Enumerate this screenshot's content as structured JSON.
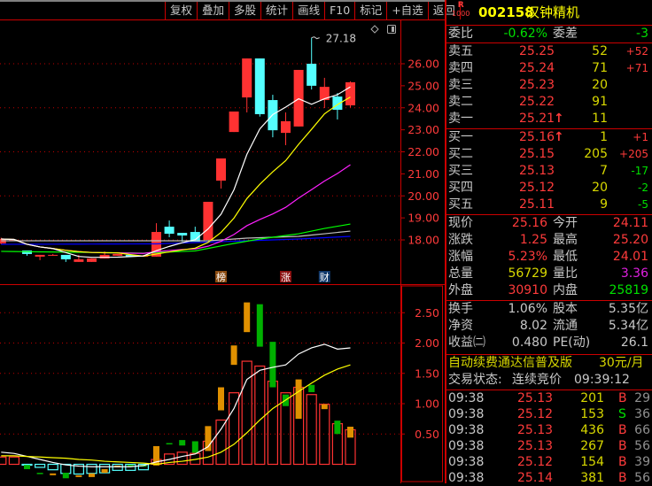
{
  "toolbar": [
    "复权",
    "叠加",
    "多股",
    "统计",
    "画线",
    "F10",
    "标记",
    "+自选",
    "返回"
  ],
  "stock": {
    "badge_top": "R",
    "badge_bottom": "1000",
    "code": "002158",
    "name": "汉钟精机"
  },
  "weibi": {
    "label": "委比",
    "value": "-0.62%",
    "label2": "委差",
    "value2": "-3"
  },
  "asks": [
    {
      "label": "卖五",
      "price": "25.25",
      "vol": "52",
      "chg": "+52",
      "chg_color": "r"
    },
    {
      "label": "卖四",
      "price": "25.24",
      "vol": "71",
      "chg": "+71",
      "chg_color": "r"
    },
    {
      "label": "卖三",
      "price": "25.23",
      "vol": "20",
      "chg": "",
      "chg_color": "r"
    },
    {
      "label": "卖二",
      "price": "25.22",
      "vol": "91",
      "chg": "",
      "chg_color": "r"
    },
    {
      "label": "卖一",
      "price": "25.21",
      "vol": "11",
      "chg": "",
      "chg_color": "r",
      "arrow": "↑"
    }
  ],
  "bids": [
    {
      "label": "买一",
      "price": "25.16",
      "vol": "1",
      "chg": "+1",
      "chg_color": "r",
      "arrow": "↑"
    },
    {
      "label": "买二",
      "price": "25.15",
      "vol": "205",
      "chg": "+205",
      "chg_color": "r"
    },
    {
      "label": "买三",
      "price": "25.13",
      "vol": "7",
      "chg": "-17",
      "chg_color": "g"
    },
    {
      "label": "买四",
      "price": "25.12",
      "vol": "20",
      "chg": "-2",
      "chg_color": "g"
    },
    {
      "label": "买五",
      "price": "25.11",
      "vol": "9",
      "chg": "-5",
      "chg_color": "g"
    }
  ],
  "quote": [
    {
      "l1": "现价",
      "v1": "25.16",
      "c1": "r",
      "l2": "今开",
      "v2": "24.11",
      "c2": "r"
    },
    {
      "l1": "涨跌",
      "v1": "1.25",
      "c1": "r",
      "l2": "最高",
      "v2": "25.20",
      "c2": "r"
    },
    {
      "l1": "涨幅",
      "v1": "5.23%",
      "c1": "r",
      "l2": "最低",
      "v2": "24.01",
      "c2": "r"
    },
    {
      "l1": "总量",
      "v1": "56729",
      "c1": "y",
      "l2": "量比",
      "v2": "3.36",
      "c2": "m"
    },
    {
      "l1": "外盘",
      "v1": "30910",
      "c1": "r",
      "l2": "内盘",
      "v2": "25819",
      "c2": "g"
    }
  ],
  "finance": [
    {
      "l1": "换手",
      "v1": "1.06%",
      "l2": "股本",
      "v2": "5.35亿"
    },
    {
      "l1": "净资",
      "v1": "8.02",
      "l2": "流通",
      "v2": "5.34亿"
    },
    {
      "l1": "收益㈡",
      "v1": "0.480",
      "l2": "PE(动)",
      "v2": "26.1"
    }
  ],
  "promo": {
    "text": "自动续费通达信普及版",
    "price": "30元/月"
  },
  "status": {
    "label": "交易状态:",
    "value": "连续竞价",
    "time": "09:39:12"
  },
  "ticks": [
    {
      "time": "09:38",
      "price": "25.13",
      "vol": "201",
      "side": "B",
      "n": "29"
    },
    {
      "time": "09:38",
      "price": "25.12",
      "vol": "153",
      "side": "S",
      "n": "36"
    },
    {
      "time": "09:38",
      "price": "25.13",
      "vol": "436",
      "side": "B",
      "n": "66"
    },
    {
      "time": "09:38",
      "price": "25.13",
      "vol": "267",
      "side": "B",
      "n": "56"
    },
    {
      "time": "09:38",
      "price": "25.12",
      "vol": "154",
      "side": "B",
      "n": "39"
    },
    {
      "time": "09:38",
      "price": "25.14",
      "vol": "381",
      "side": "B",
      "n": "56"
    }
  ],
  "markers": [
    {
      "text": "榜",
      "index": 17,
      "color": "#8a4a10"
    },
    {
      "text": "涨",
      "index": 22,
      "color": "#8a1010"
    },
    {
      "text": "财",
      "index": 25,
      "color": "#10386a"
    }
  ],
  "colors": {
    "up": "#ff3232",
    "down": "#54ffff",
    "ma5": "#ffffff",
    "ma10": "#ffff00",
    "ma20": "#ff20ff",
    "green": "#00ff00",
    "gray": "#c0c0c0",
    "blue": "#0000ff",
    "ind_up": "#e09000",
    "ind_down": "#00b000",
    "grid": "#c00000",
    "axis_text": "#ff3b3b"
  },
  "chart_data": {
    "type": "candlestick",
    "price_axis": {
      "ticks": [
        "26.00",
        "25.00",
        "24.00",
        "23.00",
        "22.00",
        "21.00",
        "20.00",
        "19.00",
        "18.00"
      ],
      "range": [
        18,
        26
      ]
    },
    "high_label": "27.18",
    "candles": [
      {
        "o": 17.84,
        "c": 18.04,
        "h": 18.1,
        "l": 17.8
      },
      {
        "o": 18.0,
        "c": 18.0,
        "h": 18.04,
        "l": 17.96
      },
      {
        "o": 17.52,
        "c": 17.36,
        "h": 17.52,
        "l": 17.28
      },
      {
        "o": 17.24,
        "c": 17.32,
        "h": 17.32,
        "l": 17.08
      },
      {
        "o": 17.32,
        "c": 17.32,
        "h": 17.36,
        "l": 17.28
      },
      {
        "o": 17.32,
        "c": 17.12,
        "h": 17.32,
        "l": 17.0
      },
      {
        "o": 17.0,
        "c": 17.12,
        "h": 17.32,
        "l": 17.0
      },
      {
        "o": 17.0,
        "c": 17.16,
        "h": 17.16,
        "l": 17.0
      },
      {
        "o": 17.16,
        "c": 17.32,
        "h": 17.48,
        "l": 17.16
      },
      {
        "o": 17.28,
        "c": 17.36,
        "h": 17.36,
        "l": 17.28
      },
      {
        "o": 17.32,
        "c": 17.24,
        "h": 17.32,
        "l": 17.24
      },
      {
        "o": 17.28,
        "c": 17.28,
        "h": 17.32,
        "l": 17.24
      },
      {
        "o": 17.24,
        "c": 18.36,
        "h": 18.76,
        "l": 17.24
      },
      {
        "o": 18.6,
        "c": 18.28,
        "h": 18.88,
        "l": 18.12
      },
      {
        "o": 18.32,
        "c": 18.2,
        "h": 18.32,
        "l": 17.92
      },
      {
        "o": 18.36,
        "c": 17.92,
        "h": 18.6,
        "l": 17.92
      },
      {
        "o": 18.0,
        "c": 19.73,
        "h": 19.73,
        "l": 18.0
      },
      {
        "o": 20.69,
        "c": 21.7,
        "h": 21.7,
        "l": 20.33
      },
      {
        "o": 22.9,
        "c": 23.83,
        "h": 23.83,
        "l": 22.9
      },
      {
        "o": 24.47,
        "c": 26.24,
        "h": 26.24,
        "l": 23.79
      },
      {
        "o": 26.24,
        "c": 23.71,
        "h": 26.24,
        "l": 23.6
      },
      {
        "o": 24.35,
        "c": 22.98,
        "h": 24.59,
        "l": 22.66
      },
      {
        "o": 22.86,
        "c": 23.39,
        "h": 23.79,
        "l": 22.3
      },
      {
        "o": 23.15,
        "c": 25.72,
        "h": 25.72,
        "l": 23.15
      },
      {
        "o": 26.0,
        "c": 25.0,
        "h": 27.18,
        "l": 24.83
      },
      {
        "o": 24.35,
        "c": 24.95,
        "h": 25.36,
        "l": 23.99
      },
      {
        "o": 24.51,
        "c": 23.91,
        "h": 24.67,
        "l": 23.47
      },
      {
        "o": 24.11,
        "c": 25.16,
        "h": 25.2,
        "l": 24.01
      }
    ],
    "long_ma": {
      "green": [
        [
          0,
          17.48
        ],
        [
          11,
          17.4
        ],
        [
          15,
          17.5
        ],
        [
          18,
          17.84
        ],
        [
          20,
          18.04
        ],
        [
          23,
          18.28
        ],
        [
          25,
          18.52
        ],
        [
          27,
          18.72
        ]
      ],
      "gray": [
        [
          0,
          17.96
        ],
        [
          16,
          17.96
        ],
        [
          19,
          18.08
        ],
        [
          23,
          18.16
        ],
        [
          27,
          18.4
        ]
      ],
      "blue": [
        [
          0,
          17.8
        ],
        [
          12,
          17.82
        ],
        [
          19,
          17.96
        ],
        [
          23,
          18.04
        ],
        [
          27,
          18.16
        ]
      ]
    },
    "lower": {
      "axis_ticks": [
        "2.50",
        "2.00",
        "1.50",
        "1.00",
        "0.50"
      ],
      "bars": [
        0.12,
        0.12,
        -0.01,
        -0.05,
        -0.09,
        -0.15,
        -0.16,
        -0.15,
        -0.14,
        -0.1,
        -0.1,
        -0.09,
        0.08,
        0.17,
        0.2,
        0.18,
        0.38,
        0.73,
        1.18,
        1.7,
        1.62,
        1.37,
        1.18,
        1.27,
        1.15,
        0.99,
        0.67,
        0.57
      ],
      "indicator": [
        null,
        null,
        [
          -0.01,
          -0.08,
          "d"
        ],
        [
          -0.14,
          -0.15,
          "d"
        ],
        [
          -0.15,
          -0.18,
          "u"
        ],
        [
          -0.14,
          -0.23,
          "d"
        ],
        [
          -0.18,
          -0.21,
          "u"
        ],
        [
          -0.15,
          -0.21,
          "u"
        ],
        [
          -0.08,
          -0.14,
          "u"
        ],
        [
          -0.02,
          -0.05,
          "u"
        ],
        [
          -0.01,
          -0.04,
          "d"
        ],
        [
          -0.01,
          -0.04,
          "d"
        ],
        [
          0.3,
          -0.02,
          "u"
        ],
        [
          0.35,
          0.34,
          "d"
        ],
        [
          0.4,
          0.31,
          "d"
        ],
        [
          0.38,
          0.19,
          "d"
        ],
        [
          0.63,
          0.22,
          "u"
        ],
        [
          1.27,
          0.89,
          "u"
        ],
        [
          1.96,
          1.64,
          "u"
        ],
        [
          2.67,
          2.18,
          "u"
        ],
        [
          2.64,
          1.94,
          "d"
        ],
        [
          2.02,
          1.27,
          "d"
        ],
        [
          1.15,
          0.96,
          "d"
        ],
        [
          1.4,
          0.75,
          "u"
        ],
        [
          1.31,
          1.19,
          "d"
        ],
        [
          0.99,
          0.91,
          "u"
        ],
        [
          0.72,
          0.5,
          "d"
        ],
        [
          0.62,
          0.44,
          "u"
        ]
      ],
      "line_white": [
        0.2,
        0.18,
        0.13,
        0.08,
        0.03,
        -0.01,
        -0.03,
        -0.04,
        -0.04,
        -0.04,
        -0.04,
        -0.02,
        0.04,
        0.08,
        0.13,
        0.17,
        0.29,
        0.58,
        0.92,
        1.4,
        1.55,
        1.6,
        1.64,
        1.82,
        1.92,
        1.98,
        1.9,
        1.92
      ],
      "line_yellow": [
        0.14,
        0.14,
        0.13,
        0.12,
        0.11,
        0.1,
        0.08,
        0.07,
        0.05,
        0.04,
        0.03,
        0.02,
        0.0,
        0.03,
        0.05,
        0.08,
        0.12,
        0.2,
        0.33,
        0.52,
        0.73,
        0.92,
        1.06,
        1.2,
        1.34,
        1.47,
        1.57,
        1.64
      ]
    }
  }
}
